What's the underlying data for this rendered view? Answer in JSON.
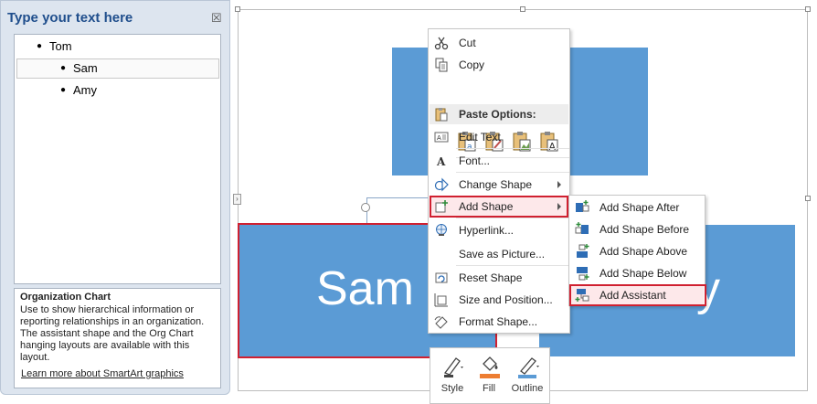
{
  "text_pane": {
    "title": "Type your text here",
    "close_glyph": "☒",
    "items": [
      {
        "bullet": "●",
        "text": "Tom"
      },
      {
        "bullet": "●",
        "text": "Sam"
      },
      {
        "bullet": "●",
        "text": "Amy"
      }
    ],
    "description": {
      "heading": "Organization Chart",
      "body": "Use to show hierarchical information or reporting relationships in an organization. The assistant shape and the Org Chart hanging layouts are available with this layout.",
      "link": "Learn more about SmartArt graphics"
    }
  },
  "canvas": {
    "left_shape_text": "Sam",
    "right_shape_text": "y",
    "shape_color": "#5b9bd5",
    "selection_color": "#d02030"
  },
  "mini_toolbar": {
    "style": "Style",
    "fill": "Fill",
    "outline": "Outline"
  },
  "context_menu": {
    "cut": "Cut",
    "copy": "Copy",
    "paste_options": "Paste Options:",
    "edit_text": "Edit Text",
    "font": "Font...",
    "change_shape": "Change Shape",
    "add_shape": "Add Shape",
    "hyperlink": "Hyperlink...",
    "save_as_picture": "Save as Picture...",
    "reset_shape": "Reset Shape",
    "size_and_position": "Size and Position...",
    "format_shape": "Format Shape..."
  },
  "add_shape_submenu": {
    "after": "Add Shape After",
    "before": "Add Shape Before",
    "above": "Add Shape Above",
    "below": "Add Shape Below",
    "assistant": "Add Assistant"
  }
}
